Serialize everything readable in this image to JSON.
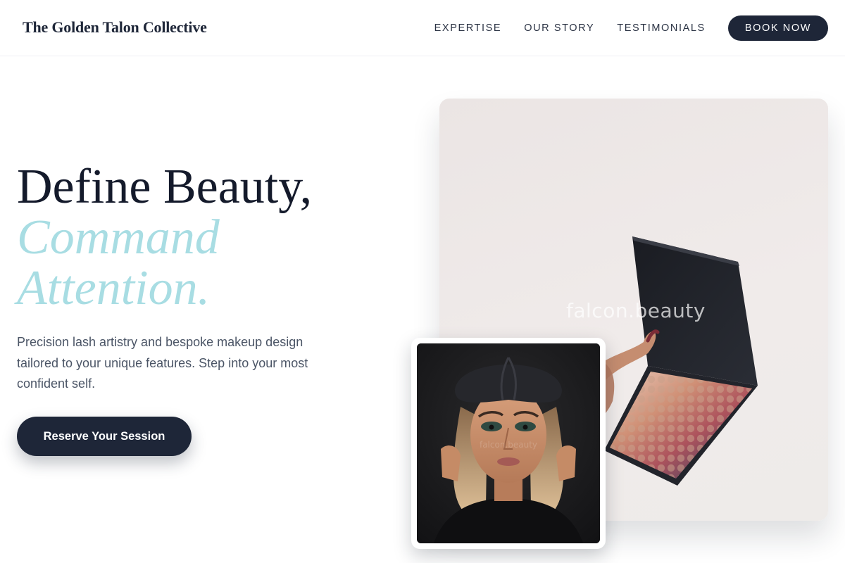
{
  "header": {
    "brand": "The Golden Talon Collective",
    "nav": [
      "EXPERTISE",
      "OUR STORY",
      "TESTIMONIALS"
    ],
    "cta_label": "BOOK NOW"
  },
  "hero": {
    "headline_line1": "Define Beauty,",
    "headline_line2": "Command Attention.",
    "lead": "Precision lash artistry and bespoke makeup design tailored to your unique features. Step into your most confident self.",
    "cta_label": "Reserve Your Session"
  },
  "images": {
    "main_watermark": "falcon.beauty",
    "portrait_watermark": "falcon.beauty"
  },
  "colors": {
    "primary": "#1e2638",
    "accent": "#a8dde3",
    "text_muted": "#4b5566"
  }
}
